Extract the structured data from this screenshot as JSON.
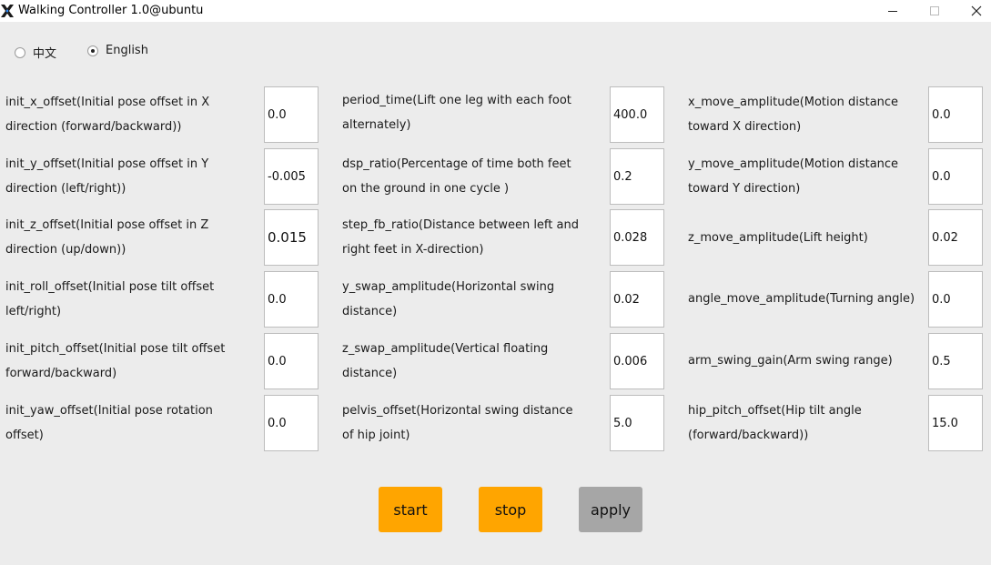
{
  "window": {
    "title": "Walking Controller 1.0@ubuntu"
  },
  "language": {
    "chinese": "中文",
    "english": "English",
    "selected": "English"
  },
  "params": {
    "init_x_offset": {
      "label": "init_x_offset(Initial pose offset in X\ndirection (forward/backward))",
      "value": "0.0"
    },
    "init_y_offset": {
      "label": "init_y_offset(Initial pose offset in Y\ndirection (left/right))",
      "value": "-0.005"
    },
    "init_z_offset": {
      "label": "init_z_offset(Initial pose offset in Z\ndirection (up/down))",
      "value": "0.015"
    },
    "init_roll_offset": {
      "label": "init_roll_offset(Initial pose tilt offset\nleft/right)",
      "value": "0.0"
    },
    "init_pitch_offset": {
      "label": "init_pitch_offset(Initial pose tilt offset\nforward/backward)",
      "value": "0.0"
    },
    "init_yaw_offset": {
      "label": "init_yaw_offset(Initial pose rotation\noffset)",
      "value": "0.0"
    },
    "period_time": {
      "label": "period_time(Lift one leg with each foot\nalternately)",
      "value": "400.0"
    },
    "dsp_ratio": {
      "label": "dsp_ratio(Percentage of time both feet\non the ground in one cycle )",
      "value": "0.2"
    },
    "step_fb_ratio": {
      "label": "step_fb_ratio(Distance between left and\nright feet in X-direction)",
      "value": "0.028"
    },
    "y_swap_amplitude": {
      "label": "y_swap_amplitude(Horizontal swing\ndistance)",
      "value": "0.02"
    },
    "z_swap_amplitude": {
      "label": "z_swap_amplitude(Vertical floating\ndistance)",
      "value": "0.006"
    },
    "pelvis_offset": {
      "label": "pelvis_offset(Horizontal swing distance\nof hip joint)",
      "value": "5.0"
    },
    "x_move_amplitude": {
      "label": "x_move_amplitude(Motion distance\ntoward X direction)",
      "value": "0.0"
    },
    "y_move_amplitude": {
      "label": "y_move_amplitude(Motion distance\ntoward Y direction)",
      "value": "0.0"
    },
    "z_move_amplitude": {
      "label": "z_move_amplitude(Lift height)",
      "value": "0.02"
    },
    "angle_move_amplitude": {
      "label": "angle_move_amplitude(Turning angle)",
      "value": "0.0"
    },
    "arm_swing_gain": {
      "label": "arm_swing_gain(Arm swing range)",
      "value": "0.5"
    },
    "hip_pitch_offset": {
      "label": "hip_pitch_offset(Hip tilt angle\n(forward/backward))",
      "value": "15.0"
    }
  },
  "buttons": {
    "start": "start",
    "stop": "stop",
    "apply": "apply"
  },
  "colors": {
    "start_bg": "#ffa500",
    "stop_bg": "#ffa500",
    "apply_bg": "#a6a6a6",
    "window_bg": "#ececec"
  }
}
